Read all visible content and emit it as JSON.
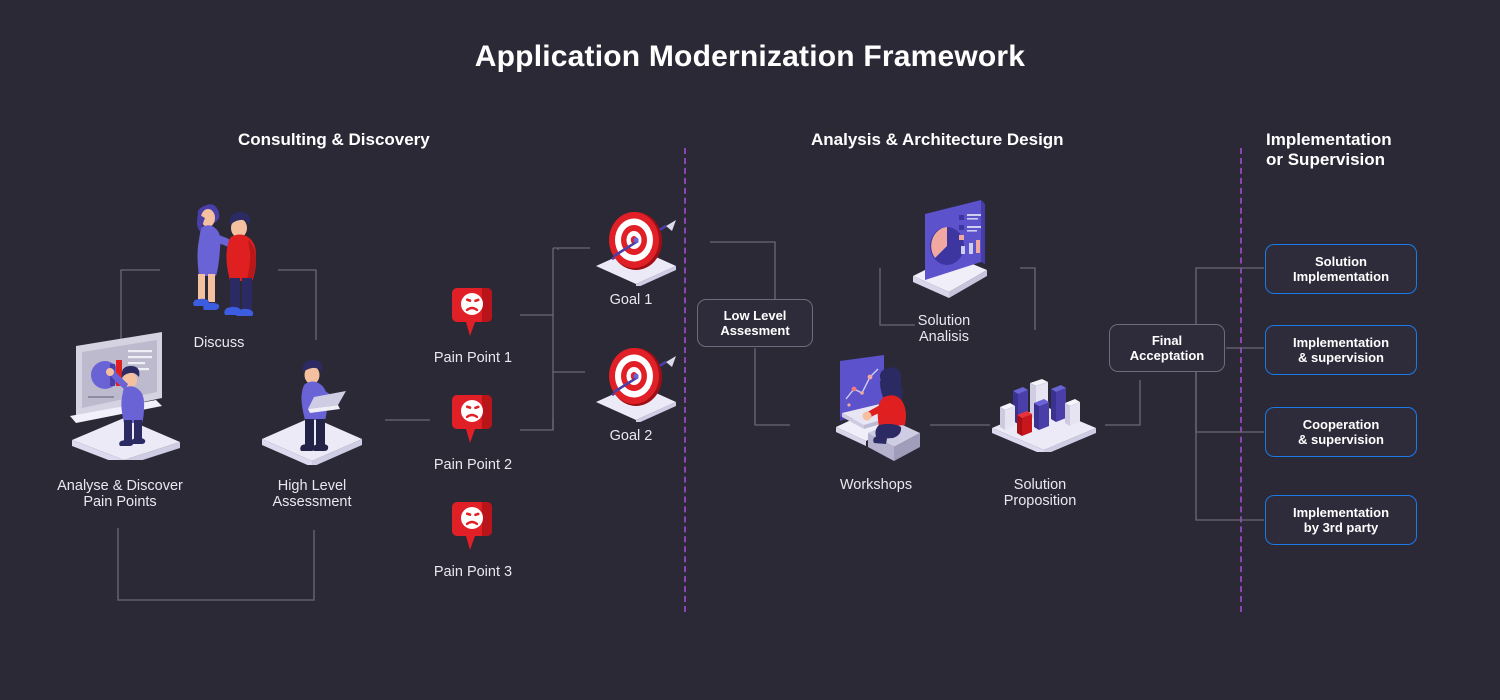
{
  "page": {
    "title": "Application Modernization Framework",
    "background_color": "#2b2936",
    "accent_blue": "#1a7ae8",
    "divider_purple": "#8e45b4",
    "connector_gray": "#6a6878"
  },
  "sections": [
    {
      "id": "consulting",
      "title": "Consulting & Discovery"
    },
    {
      "id": "analysis",
      "title": "Analysis & Architecture Design"
    },
    {
      "id": "implementation",
      "title_line1": "Implementation",
      "title_line2": "or Supervision"
    }
  ],
  "nodes": {
    "discuss": {
      "label": "Discuss",
      "icon": "two-people-discussing-illustration"
    },
    "analyse": {
      "label_line1": "Analyse & Discover",
      "label_line2": "Pain Points",
      "icon": "person-at-dashboard-illustration"
    },
    "high_level": {
      "label_line1": "High Level",
      "label_line2": "Assessment",
      "icon": "person-with-laptop-illustration"
    },
    "pain_point_1": {
      "label": "Pain Point 1",
      "icon": "sad-face-pin-icon"
    },
    "pain_point_2": {
      "label": "Pain Point 2",
      "icon": "sad-face-pin-icon"
    },
    "pain_point_3": {
      "label": "Pain Point 3",
      "icon": "sad-face-pin-icon"
    },
    "goal_1": {
      "label": "Goal 1",
      "icon": "target-with-arrow-icon"
    },
    "goal_2": {
      "label": "Goal 2",
      "icon": "target-with-arrow-icon"
    },
    "solution_analisis": {
      "label_line1": "Solution",
      "label_line2": "Analisis",
      "icon": "laptop-chart-illustration"
    },
    "workshops": {
      "label": "Workshops",
      "icon": "person-at-computer-illustration"
    },
    "solution_proposition": {
      "label_line1": "Solution",
      "label_line2": "Proposition",
      "icon": "bar-chart-blocks-illustration"
    }
  },
  "boxes": {
    "low_level": {
      "line1": "Low Level",
      "line2": "Assesment",
      "style": "gray"
    },
    "final": {
      "line1": "Final",
      "line2": "Acceptation",
      "style": "gray"
    },
    "outcomes": [
      {
        "id": "solution-implementation",
        "line1": "Solution",
        "line2": "Implementation",
        "style": "blue"
      },
      {
        "id": "implementation-supervision",
        "line1": "Implementation",
        "line2": "& supervision",
        "style": "blue"
      },
      {
        "id": "cooperation-supervision",
        "line1": "Cooperation",
        "line2": "& supervision",
        "style": "blue"
      },
      {
        "id": "implementation-3rd-party",
        "line1": "Implementation",
        "line2": "by 3rd party",
        "style": "blue"
      }
    ]
  }
}
